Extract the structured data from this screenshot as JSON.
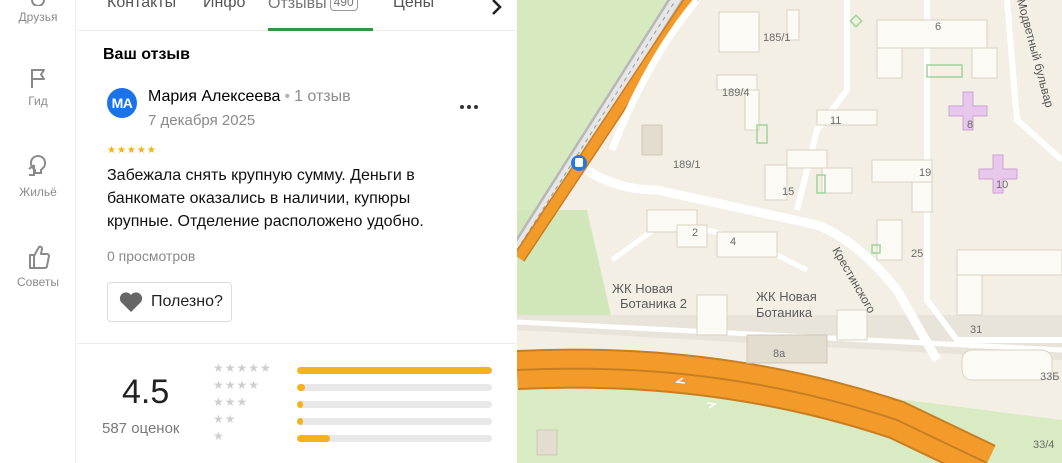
{
  "rail": [
    {
      "label": "Друзья",
      "icon": "friends-icon"
    },
    {
      "label": "Гид",
      "icon": "flag-icon"
    },
    {
      "label": "Жильё",
      "icon": "house-icon"
    },
    {
      "label": "Советы",
      "icon": "thumbs-up-icon"
    }
  ],
  "tabs": {
    "contacts": "Контакты",
    "info": "Инфо",
    "reviews": "Отзывы",
    "reviews_count": "490",
    "prices": "Цены"
  },
  "review": {
    "section_title": "Ваш отзыв",
    "avatar_initials": "МА",
    "author": "Мария Алексеева",
    "separator": "•",
    "author_reviews": "1 отзыв",
    "date": "7 декабря 2025",
    "stars": "★★★★★",
    "rating": 5,
    "text": "Забежала снять крупную сумму. Деньги в банкомате оказались в наличии, купюры крупные. Отделение расположено удобно.",
    "views": "0 просмотров",
    "useful_label": "Полезно?"
  },
  "summary": {
    "rating": "4.5",
    "count": "587 оценок",
    "distribution": [
      {
        "stars": "★★★★★",
        "share": 1.0
      },
      {
        "stars": "★★★★",
        "share": 0.04
      },
      {
        "stars": "★★★",
        "share": 0.02
      },
      {
        "stars": "★★",
        "share": 0.03
      },
      {
        "stars": "★",
        "share": 0.17
      }
    ]
  },
  "map": {
    "labels": {
      "h185_1": "185/1",
      "h6": "6",
      "h189_4": "189/4",
      "h11": "11",
      "h8": "8",
      "h189_1": "189/1",
      "h15": "15",
      "h19": "19",
      "h10": "10",
      "h2": "2",
      "h4": "4",
      "h25": "25",
      "jk1_line1": "ЖК Новая",
      "jk1_line2": "Ботаника 2",
      "jk2_line1": "ЖК Новая",
      "jk2_line2": "Ботаника",
      "h31": "31",
      "h8a": "8а",
      "h33b": "33Б",
      "h33_4": "33/4",
      "street_krest": "Крестинского",
      "street_bulvar": "Модветный бульвар"
    }
  },
  "colors": {
    "accent_green": "#2c9a3d",
    "star_yellow": "#f5b500",
    "bar_fill": "#f5b21b",
    "avatar_blue": "#1a73e8",
    "road_orange": "#f39b2a"
  }
}
